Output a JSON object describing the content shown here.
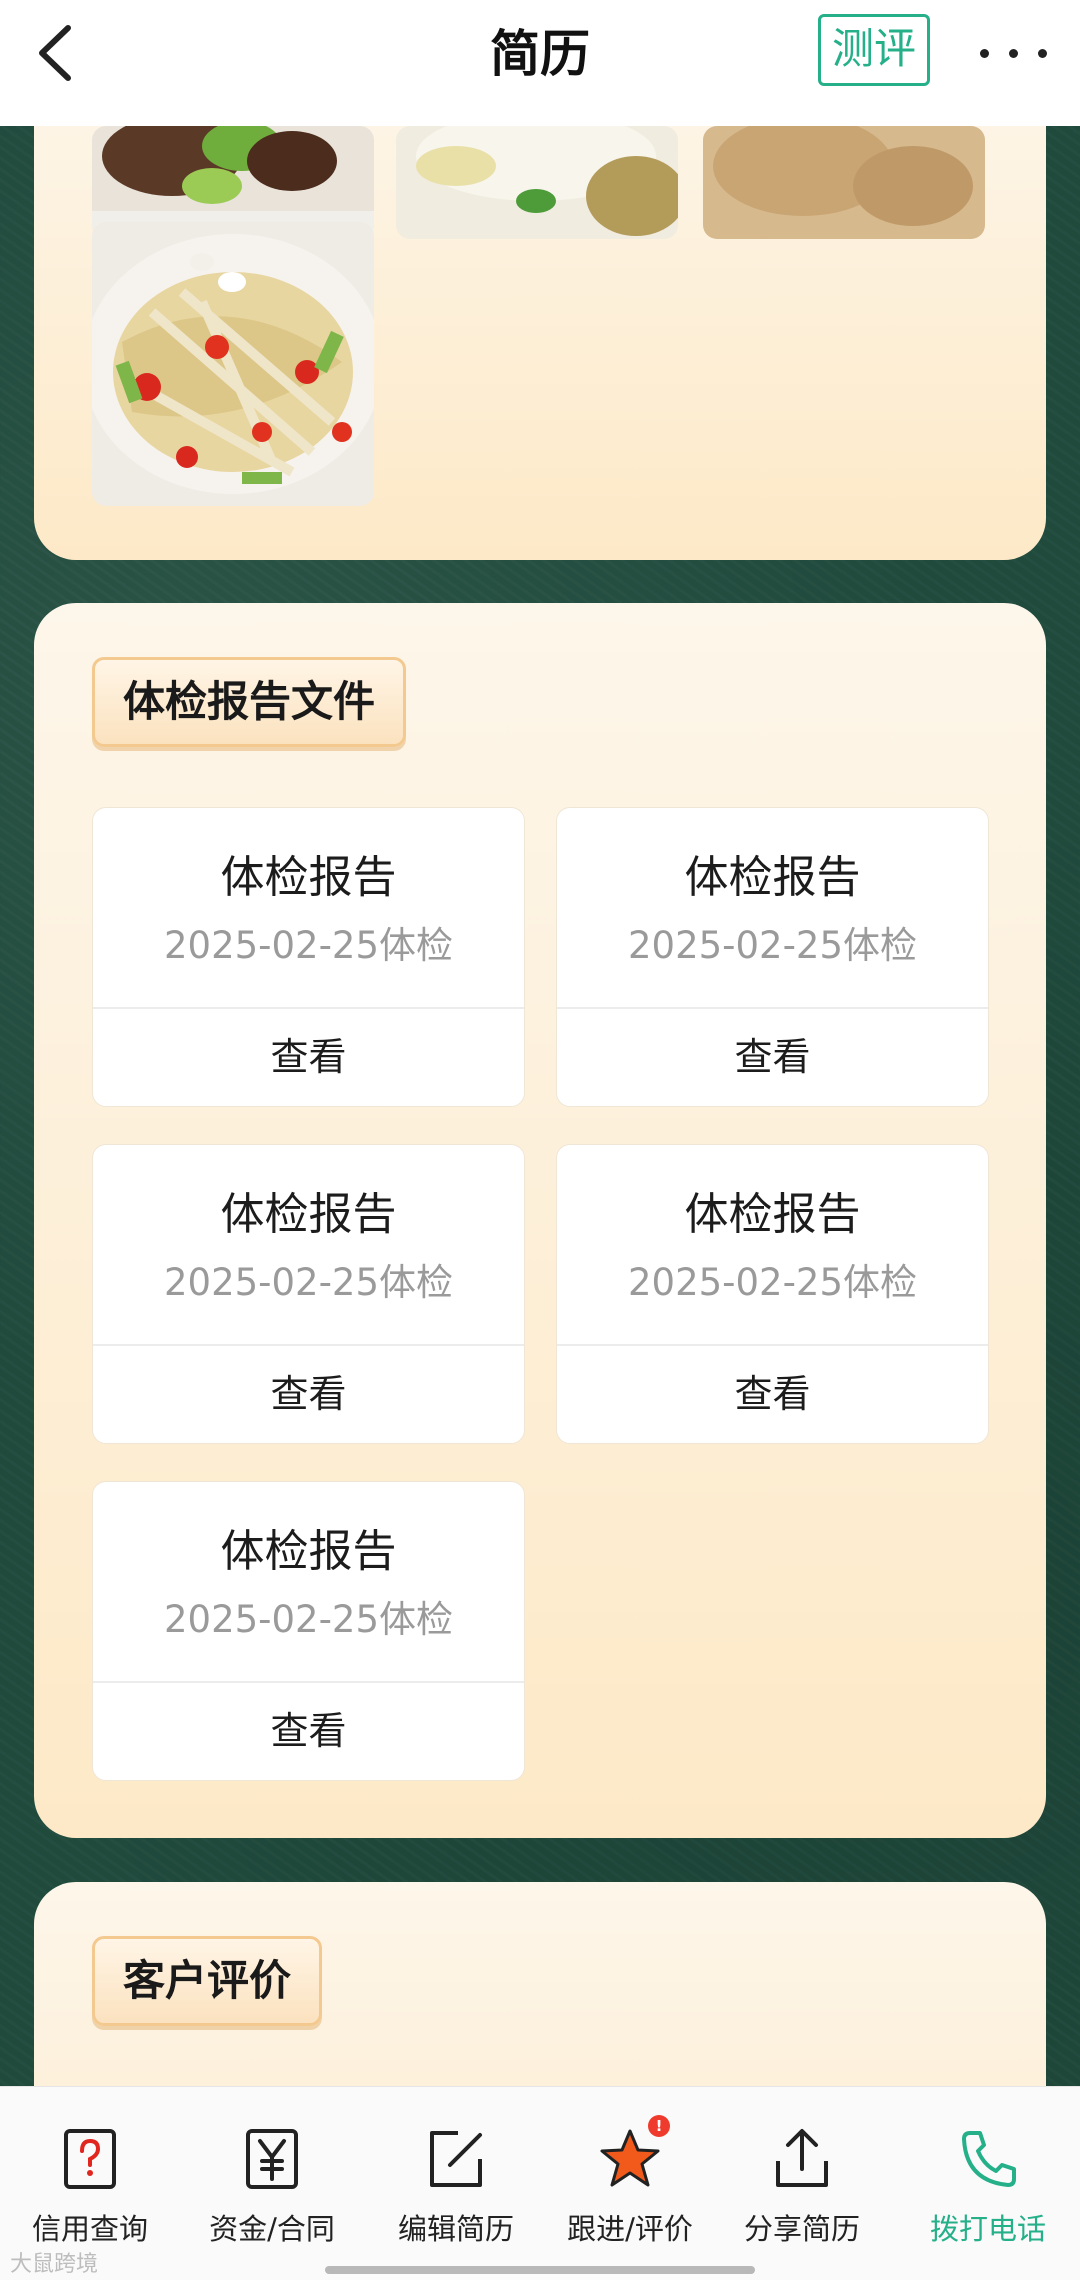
{
  "header": {
    "title": "简历",
    "eval_label": "测评",
    "back_icon": "chevron-left-icon",
    "more_icon": "more-dots-icon"
  },
  "photos": {
    "items": [
      "food-photo",
      "food-photo",
      "food-photo",
      "food-photo"
    ]
  },
  "reports_section": {
    "title": "体检报告文件",
    "items": [
      {
        "title": "体检报告",
        "date": "2025-02-25体检",
        "action": "查看"
      },
      {
        "title": "体检报告",
        "date": "2025-02-25体检",
        "action": "查看"
      },
      {
        "title": "体检报告",
        "date": "2025-02-25体检",
        "action": "查看"
      },
      {
        "title": "体检报告",
        "date": "2025-02-25体检",
        "action": "查看"
      },
      {
        "title": "体检报告",
        "date": "2025-02-25体检",
        "action": "查看"
      }
    ]
  },
  "reviews_section": {
    "title": "客户评价"
  },
  "bottom_nav": {
    "items": [
      {
        "label": "信用查询",
        "icon": "credit-query-icon"
      },
      {
        "label": "资金/合同",
        "icon": "yen-icon"
      },
      {
        "label": "编辑简历",
        "icon": "edit-icon"
      },
      {
        "label": "跟进/评价",
        "icon": "star-icon",
        "badge": "!"
      },
      {
        "label": "分享简历",
        "icon": "share-icon"
      },
      {
        "label": "拨打电话",
        "icon": "phone-icon"
      }
    ]
  },
  "watermark": "大鼠跨境",
  "colors": {
    "accent": "#25b08a",
    "card_bg": "#fde9c7",
    "background": "#1f4a3c",
    "badge": "#ef3b2d",
    "star": "#f25a1c"
  }
}
